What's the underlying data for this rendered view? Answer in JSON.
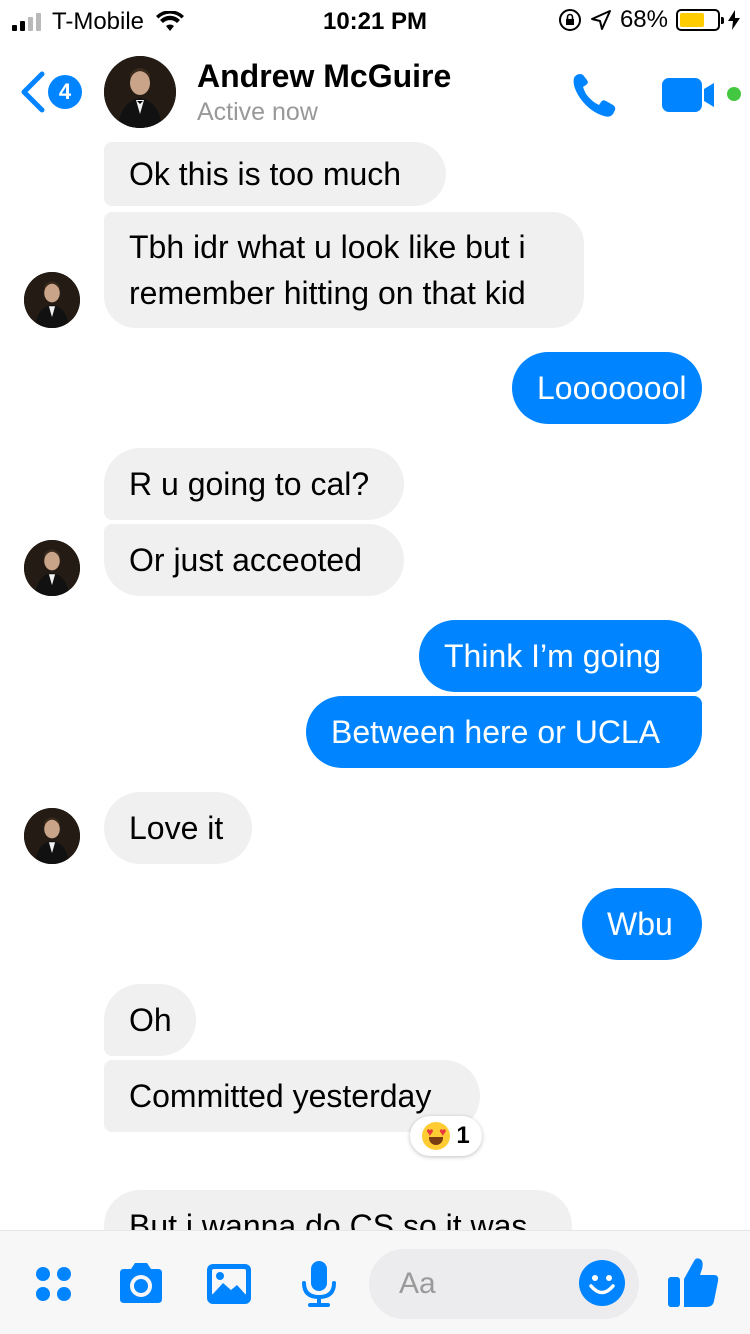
{
  "status_bar": {
    "carrier": "T-Mobile",
    "time": "10:21 PM",
    "battery": "68%",
    "battery_level": 0.68
  },
  "header": {
    "back_badge": "4",
    "name": "Andrew McGuire",
    "status": "Active now"
  },
  "messages": [
    {
      "dir": "in",
      "text": "Ok this is too much"
    },
    {
      "dir": "in",
      "text": "Tbh idr what u look like but i"
    },
    {
      "dir": "in",
      "text": "remember hitting on that kid"
    },
    {
      "dir": "out",
      "text": "Loooooool"
    },
    {
      "dir": "in",
      "text": "R u going to cal?"
    },
    {
      "dir": "in",
      "text": "Or just acceoted"
    },
    {
      "dir": "out",
      "text": "Think I’m going"
    },
    {
      "dir": "out",
      "text": "Between here or UCLA"
    },
    {
      "dir": "in",
      "text": "Love it"
    },
    {
      "dir": "out",
      "text": "Wbu"
    },
    {
      "dir": "in",
      "text": "Oh"
    },
    {
      "dir": "in",
      "text": "Committed yesterday"
    },
    {
      "dir": "in",
      "text": "But i wanna do CS so it was"
    }
  ],
  "reaction": {
    "emoji": "heart-eyes",
    "count": "1"
  },
  "composer": {
    "placeholder": "Aa"
  },
  "colors": {
    "accent": "#0084ff",
    "incoming": "#f1f0f0",
    "active": "#44c740"
  }
}
